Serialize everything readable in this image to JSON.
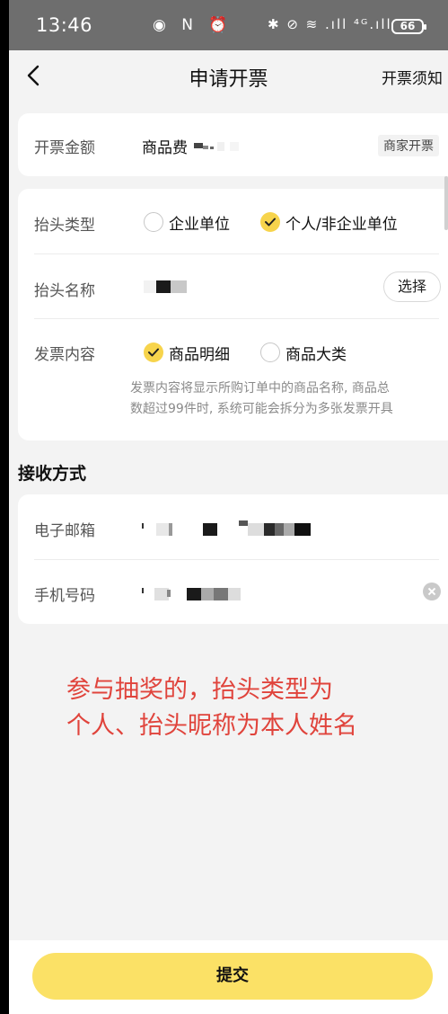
{
  "status_bar": {
    "time": "13:46",
    "icons_mid": "◉ N ⏰",
    "icons_right": "✱ ⊘ ≋ .ıll ⁴ᴳ.ıll",
    "battery": "66"
  },
  "header": {
    "title": "申请开票",
    "right_link": "开票须知",
    "back_icon": "chevron-left-icon"
  },
  "amount_card": {
    "label": "开票金额",
    "value_prefix": "商品费",
    "tag": "商家开票"
  },
  "invoice_card": {
    "title_type_label": "抬头类型",
    "title_type_options": [
      {
        "label": "企业单位",
        "checked": false
      },
      {
        "label": "个人/非企业单位",
        "checked": true
      }
    ],
    "title_name_label": "抬头名称",
    "choose_button": "选择",
    "content_label": "发票内容",
    "content_options": [
      {
        "label": "商品明细",
        "checked": true
      },
      {
        "label": "商品大类",
        "checked": false
      }
    ],
    "content_hint_line1": "发票内容将显示所购订单中的商品名称, 商品总",
    "content_hint_line2": "数超过99件时, 系统可能会拆分为多张发票开具"
  },
  "receive": {
    "section_title": "接收方式",
    "email_label": "电子邮箱",
    "phone_label": "手机号码"
  },
  "annotation": {
    "line1": "参与抽奖的，抬头类型为",
    "line2": "个人、抬头昵称为本人姓名"
  },
  "footer": {
    "submit_label": "提交"
  },
  "colors": {
    "accent": "#fbe166",
    "check": "#f7d44c",
    "annotation": "#e0443c"
  }
}
